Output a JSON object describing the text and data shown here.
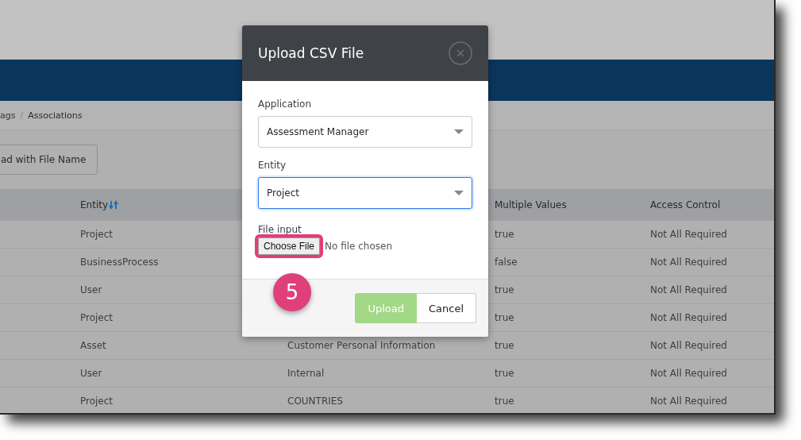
{
  "breadcrumb": {
    "separator": "/",
    "items": [
      {
        "label": "ags"
      },
      {
        "label": "Associations"
      }
    ]
  },
  "toolbar": {
    "button": "ad with File Name"
  },
  "table": {
    "columns": [
      {
        "label": "Entity",
        "sortable": true
      },
      {
        "label": "Multiple Values",
        "sortable": false
      },
      {
        "label": "Access Control",
        "sortable": false
      }
    ],
    "rows": [
      {
        "entity": "Project",
        "multiple_values": "true",
        "access_control": "Not All Required"
      },
      {
        "entity": "BusinessProcess",
        "multiple_values": "false",
        "access_control": "Not All Required"
      },
      {
        "entity": "User",
        "multiple_values": "true",
        "access_control": "Not All Required"
      },
      {
        "entity": "Project",
        "multiple_values": "true",
        "access_control": "Not All Required"
      },
      {
        "entity": "Asset",
        "column_3": "Customer Personal Information",
        "multiple_values": "true",
        "access_control": "Not All Required"
      },
      {
        "entity": "User",
        "column_3": "Internal",
        "multiple_values": "true",
        "access_control": "Not All Required"
      },
      {
        "entity": "Project",
        "column_3": "COUNTRIES",
        "multiple_values": "true",
        "access_control": "Not All Required"
      }
    ]
  },
  "modal": {
    "title": "Upload CSV File",
    "fields": [
      {
        "label": "Application",
        "value": "Assessment Manager",
        "focused": false
      },
      {
        "label": "Entity",
        "value": "Project",
        "focused": true
      }
    ],
    "file_input": {
      "label": "File input",
      "button": "Choose File",
      "status": "No file chosen",
      "highlighted": true
    },
    "buttons": [
      {
        "label": "Upload",
        "kind": "primary",
        "disabled": true
      },
      {
        "label": "Cancel",
        "kind": "secondary",
        "disabled": false
      }
    ]
  },
  "callout": {
    "step": "5"
  }
}
